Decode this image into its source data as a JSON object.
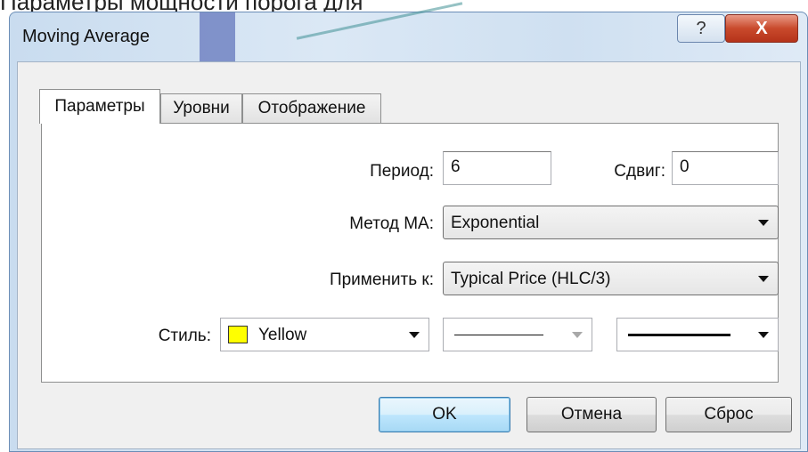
{
  "background": {
    "top_text": "Параметры мощности порога для"
  },
  "window": {
    "title": "Moving Average",
    "help_glyph": "?",
    "close_glyph": "X"
  },
  "tabs": [
    {
      "label": "Параметры",
      "active": true
    },
    {
      "label": "Уровни",
      "active": false
    },
    {
      "label": "Отображение",
      "active": false
    }
  ],
  "params": {
    "period_label": "Период:",
    "period_value": "6",
    "shift_label": "Сдвиг:",
    "shift_value": "0",
    "method_label": "Метод MA:",
    "method_value": "Exponential",
    "apply_label": "Применить к:",
    "apply_value": "Typical Price (HLC/3)",
    "style_label": "Стиль:",
    "color_value": "Yellow",
    "color_hex": "#ffff00"
  },
  "buttons": {
    "ok": "OK",
    "cancel": "Отмена",
    "reset": "Сброс"
  }
}
